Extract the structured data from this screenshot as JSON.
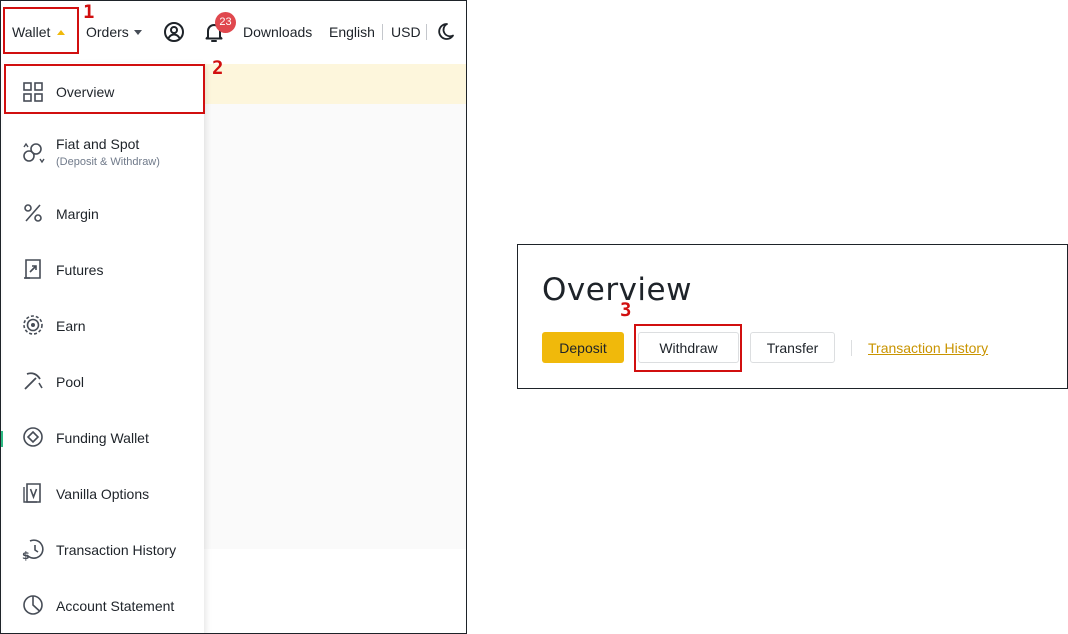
{
  "topbar": {
    "wallet_label": "Wallet",
    "orders_label": "Orders",
    "notification_count": "23",
    "downloads_label": "Downloads",
    "language_label": "English",
    "currency_label": "USD"
  },
  "wallet_menu": {
    "items": [
      {
        "label": "Overview",
        "icon": "grid-icon"
      },
      {
        "label": "Fiat and Spot",
        "sublabel": "(Deposit & Withdraw)",
        "icon": "coins-exchange-icon"
      },
      {
        "label": "Margin",
        "icon": "percent-icon"
      },
      {
        "label": "Futures",
        "icon": "futures-chart-icon"
      },
      {
        "label": "Earn",
        "icon": "target-icon"
      },
      {
        "label": "Pool",
        "icon": "pickaxe-icon"
      },
      {
        "label": "Funding Wallet",
        "icon": "funding-coin-icon"
      },
      {
        "label": "Vanilla Options",
        "icon": "vanilla-options-icon"
      },
      {
        "label": "Transaction History",
        "icon": "dollar-history-icon"
      },
      {
        "label": "Account Statement",
        "icon": "pie-chart-icon"
      }
    ]
  },
  "overview_panel": {
    "title": "Overview",
    "deposit_label": "Deposit",
    "withdraw_label": "Withdraw",
    "transfer_label": "Transfer",
    "transaction_history_label": "Transaction History"
  },
  "annotations": {
    "step1": "1",
    "step2": "2",
    "step3": "3"
  },
  "colors": {
    "accent": "#f0b90b",
    "annotation": "#d10f0f",
    "badge": "#e0484e",
    "link": "#c99400"
  }
}
